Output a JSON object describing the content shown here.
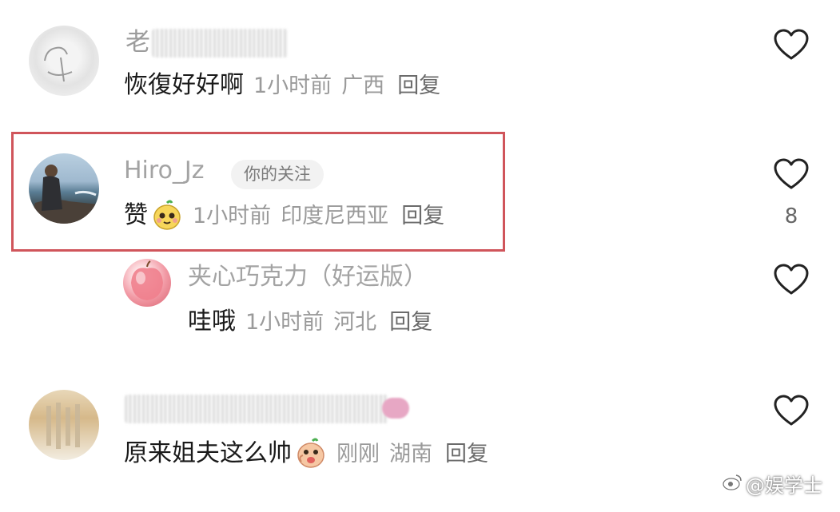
{
  "comments": [
    {
      "name_visible": "老",
      "content": "恢復好好啊",
      "time": "1小时前",
      "location": "广西",
      "reply_label": "回复"
    },
    {
      "name": "Hiro_Jz",
      "badge": "你的关注",
      "content": "赞",
      "time": "1小时前",
      "location": "印度尼西亚",
      "reply_label": "回复",
      "like_count": "8"
    },
    {
      "name": "夹心巧克力（好运版）",
      "content": "哇哦",
      "time": "1小时前",
      "location": "河北",
      "reply_label": "回复"
    },
    {
      "content": "原来姐夫这么帅",
      "time": "刚刚",
      "location": "湖南",
      "reply_label": "回复"
    }
  ],
  "watermark": "@娱学士",
  "colors": {
    "highlight_border": "#d0555b",
    "name_gray": "#a3a3a3",
    "meta_gray": "#9a9a9a"
  },
  "icons": [
    "heart-outline-icon",
    "emoji-icon",
    "weibo-icon"
  ]
}
